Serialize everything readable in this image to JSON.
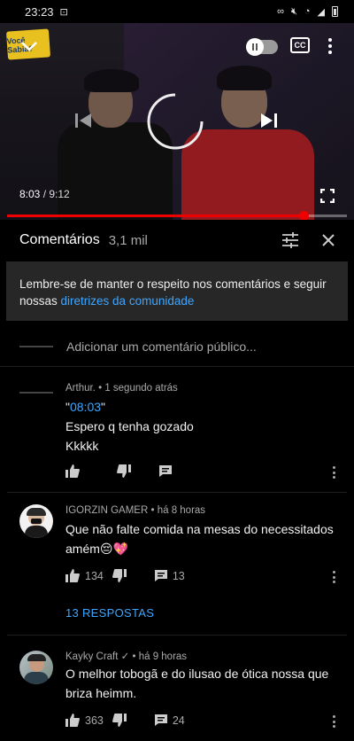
{
  "status_bar": {
    "time": "23:23"
  },
  "player": {
    "current_time": "8:03",
    "duration": "9:12",
    "time_separator": " / ",
    "progress_fraction": 0.873,
    "channel_logo_text": "Você Sabia?"
  },
  "comments_panel": {
    "title": "Comentários",
    "count": "3,1 mil",
    "notice_text": "Lembre-se de manter o respeito nos comentários e seguir nossas ",
    "notice_link": "diretrizes da comunidade",
    "add_comment_placeholder": "Adicionar um comentário público..."
  },
  "comments": [
    {
      "author": "Arthur.",
      "time": "1 segundo atrás",
      "timestamp_link": "08:03",
      "lines": [
        "Espero q tenha gozado",
        "Kkkkk"
      ],
      "likes": "",
      "replies": ""
    },
    {
      "author": "IGORZIN GAMER",
      "time": "há 8 horas",
      "lines": [
        "Que não falte comida na mesas do necessitados",
        "amém😔💖"
      ],
      "likes": "134",
      "replies": "13",
      "replies_link": "13 RESPOSTAS"
    },
    {
      "author": "Kayky Craft",
      "verified": "✓",
      "time": "há 9 horas",
      "lines": [
        "O melhor tobogã e do ilusao de ótica nossa que",
        "briza heimm."
      ],
      "likes": "363",
      "replies": "24"
    }
  ],
  "colors": {
    "accent_red": "#ff0000",
    "link_blue": "#3ea6ff",
    "notice_bg": "#272727"
  },
  "icons": [
    "chevron-down-icon",
    "pause-icon",
    "cc-icon",
    "more-vert-icon",
    "previous-icon",
    "loading-spinner-icon",
    "next-icon",
    "fullscreen-icon",
    "filter-icon",
    "close-icon",
    "thumb-up-icon",
    "thumb-down-icon",
    "reply-icon"
  ]
}
